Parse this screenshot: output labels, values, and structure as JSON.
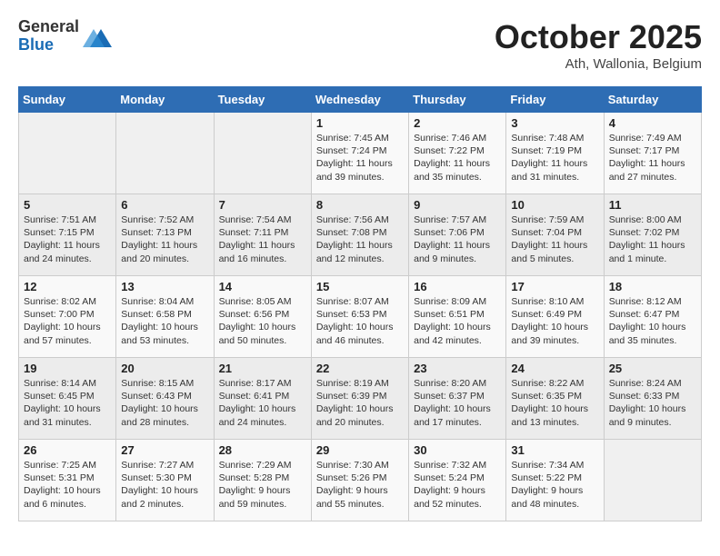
{
  "header": {
    "logo_general": "General",
    "logo_blue": "Blue",
    "month_title": "October 2025",
    "location": "Ath, Wallonia, Belgium"
  },
  "days_of_week": [
    "Sunday",
    "Monday",
    "Tuesday",
    "Wednesday",
    "Thursday",
    "Friday",
    "Saturday"
  ],
  "weeks": [
    [
      {
        "day": "",
        "text": ""
      },
      {
        "day": "",
        "text": ""
      },
      {
        "day": "",
        "text": ""
      },
      {
        "day": "1",
        "text": "Sunrise: 7:45 AM\nSunset: 7:24 PM\nDaylight: 11 hours\nand 39 minutes."
      },
      {
        "day": "2",
        "text": "Sunrise: 7:46 AM\nSunset: 7:22 PM\nDaylight: 11 hours\nand 35 minutes."
      },
      {
        "day": "3",
        "text": "Sunrise: 7:48 AM\nSunset: 7:19 PM\nDaylight: 11 hours\nand 31 minutes."
      },
      {
        "day": "4",
        "text": "Sunrise: 7:49 AM\nSunset: 7:17 PM\nDaylight: 11 hours\nand 27 minutes."
      }
    ],
    [
      {
        "day": "5",
        "text": "Sunrise: 7:51 AM\nSunset: 7:15 PM\nDaylight: 11 hours\nand 24 minutes."
      },
      {
        "day": "6",
        "text": "Sunrise: 7:52 AM\nSunset: 7:13 PM\nDaylight: 11 hours\nand 20 minutes."
      },
      {
        "day": "7",
        "text": "Sunrise: 7:54 AM\nSunset: 7:11 PM\nDaylight: 11 hours\nand 16 minutes."
      },
      {
        "day": "8",
        "text": "Sunrise: 7:56 AM\nSunset: 7:08 PM\nDaylight: 11 hours\nand 12 minutes."
      },
      {
        "day": "9",
        "text": "Sunrise: 7:57 AM\nSunset: 7:06 PM\nDaylight: 11 hours\nand 9 minutes."
      },
      {
        "day": "10",
        "text": "Sunrise: 7:59 AM\nSunset: 7:04 PM\nDaylight: 11 hours\nand 5 minutes."
      },
      {
        "day": "11",
        "text": "Sunrise: 8:00 AM\nSunset: 7:02 PM\nDaylight: 11 hours\nand 1 minute."
      }
    ],
    [
      {
        "day": "12",
        "text": "Sunrise: 8:02 AM\nSunset: 7:00 PM\nDaylight: 10 hours\nand 57 minutes."
      },
      {
        "day": "13",
        "text": "Sunrise: 8:04 AM\nSunset: 6:58 PM\nDaylight: 10 hours\nand 53 minutes."
      },
      {
        "day": "14",
        "text": "Sunrise: 8:05 AM\nSunset: 6:56 PM\nDaylight: 10 hours\nand 50 minutes."
      },
      {
        "day": "15",
        "text": "Sunrise: 8:07 AM\nSunset: 6:53 PM\nDaylight: 10 hours\nand 46 minutes."
      },
      {
        "day": "16",
        "text": "Sunrise: 8:09 AM\nSunset: 6:51 PM\nDaylight: 10 hours\nand 42 minutes."
      },
      {
        "day": "17",
        "text": "Sunrise: 8:10 AM\nSunset: 6:49 PM\nDaylight: 10 hours\nand 39 minutes."
      },
      {
        "day": "18",
        "text": "Sunrise: 8:12 AM\nSunset: 6:47 PM\nDaylight: 10 hours\nand 35 minutes."
      }
    ],
    [
      {
        "day": "19",
        "text": "Sunrise: 8:14 AM\nSunset: 6:45 PM\nDaylight: 10 hours\nand 31 minutes."
      },
      {
        "day": "20",
        "text": "Sunrise: 8:15 AM\nSunset: 6:43 PM\nDaylight: 10 hours\nand 28 minutes."
      },
      {
        "day": "21",
        "text": "Sunrise: 8:17 AM\nSunset: 6:41 PM\nDaylight: 10 hours\nand 24 minutes."
      },
      {
        "day": "22",
        "text": "Sunrise: 8:19 AM\nSunset: 6:39 PM\nDaylight: 10 hours\nand 20 minutes."
      },
      {
        "day": "23",
        "text": "Sunrise: 8:20 AM\nSunset: 6:37 PM\nDaylight: 10 hours\nand 17 minutes."
      },
      {
        "day": "24",
        "text": "Sunrise: 8:22 AM\nSunset: 6:35 PM\nDaylight: 10 hours\nand 13 minutes."
      },
      {
        "day": "25",
        "text": "Sunrise: 8:24 AM\nSunset: 6:33 PM\nDaylight: 10 hours\nand 9 minutes."
      }
    ],
    [
      {
        "day": "26",
        "text": "Sunrise: 7:25 AM\nSunset: 5:31 PM\nDaylight: 10 hours\nand 6 minutes."
      },
      {
        "day": "27",
        "text": "Sunrise: 7:27 AM\nSunset: 5:30 PM\nDaylight: 10 hours\nand 2 minutes."
      },
      {
        "day": "28",
        "text": "Sunrise: 7:29 AM\nSunset: 5:28 PM\nDaylight: 9 hours\nand 59 minutes."
      },
      {
        "day": "29",
        "text": "Sunrise: 7:30 AM\nSunset: 5:26 PM\nDaylight: 9 hours\nand 55 minutes."
      },
      {
        "day": "30",
        "text": "Sunrise: 7:32 AM\nSunset: 5:24 PM\nDaylight: 9 hours\nand 52 minutes."
      },
      {
        "day": "31",
        "text": "Sunrise: 7:34 AM\nSunset: 5:22 PM\nDaylight: 9 hours\nand 48 minutes."
      },
      {
        "day": "",
        "text": ""
      }
    ]
  ]
}
